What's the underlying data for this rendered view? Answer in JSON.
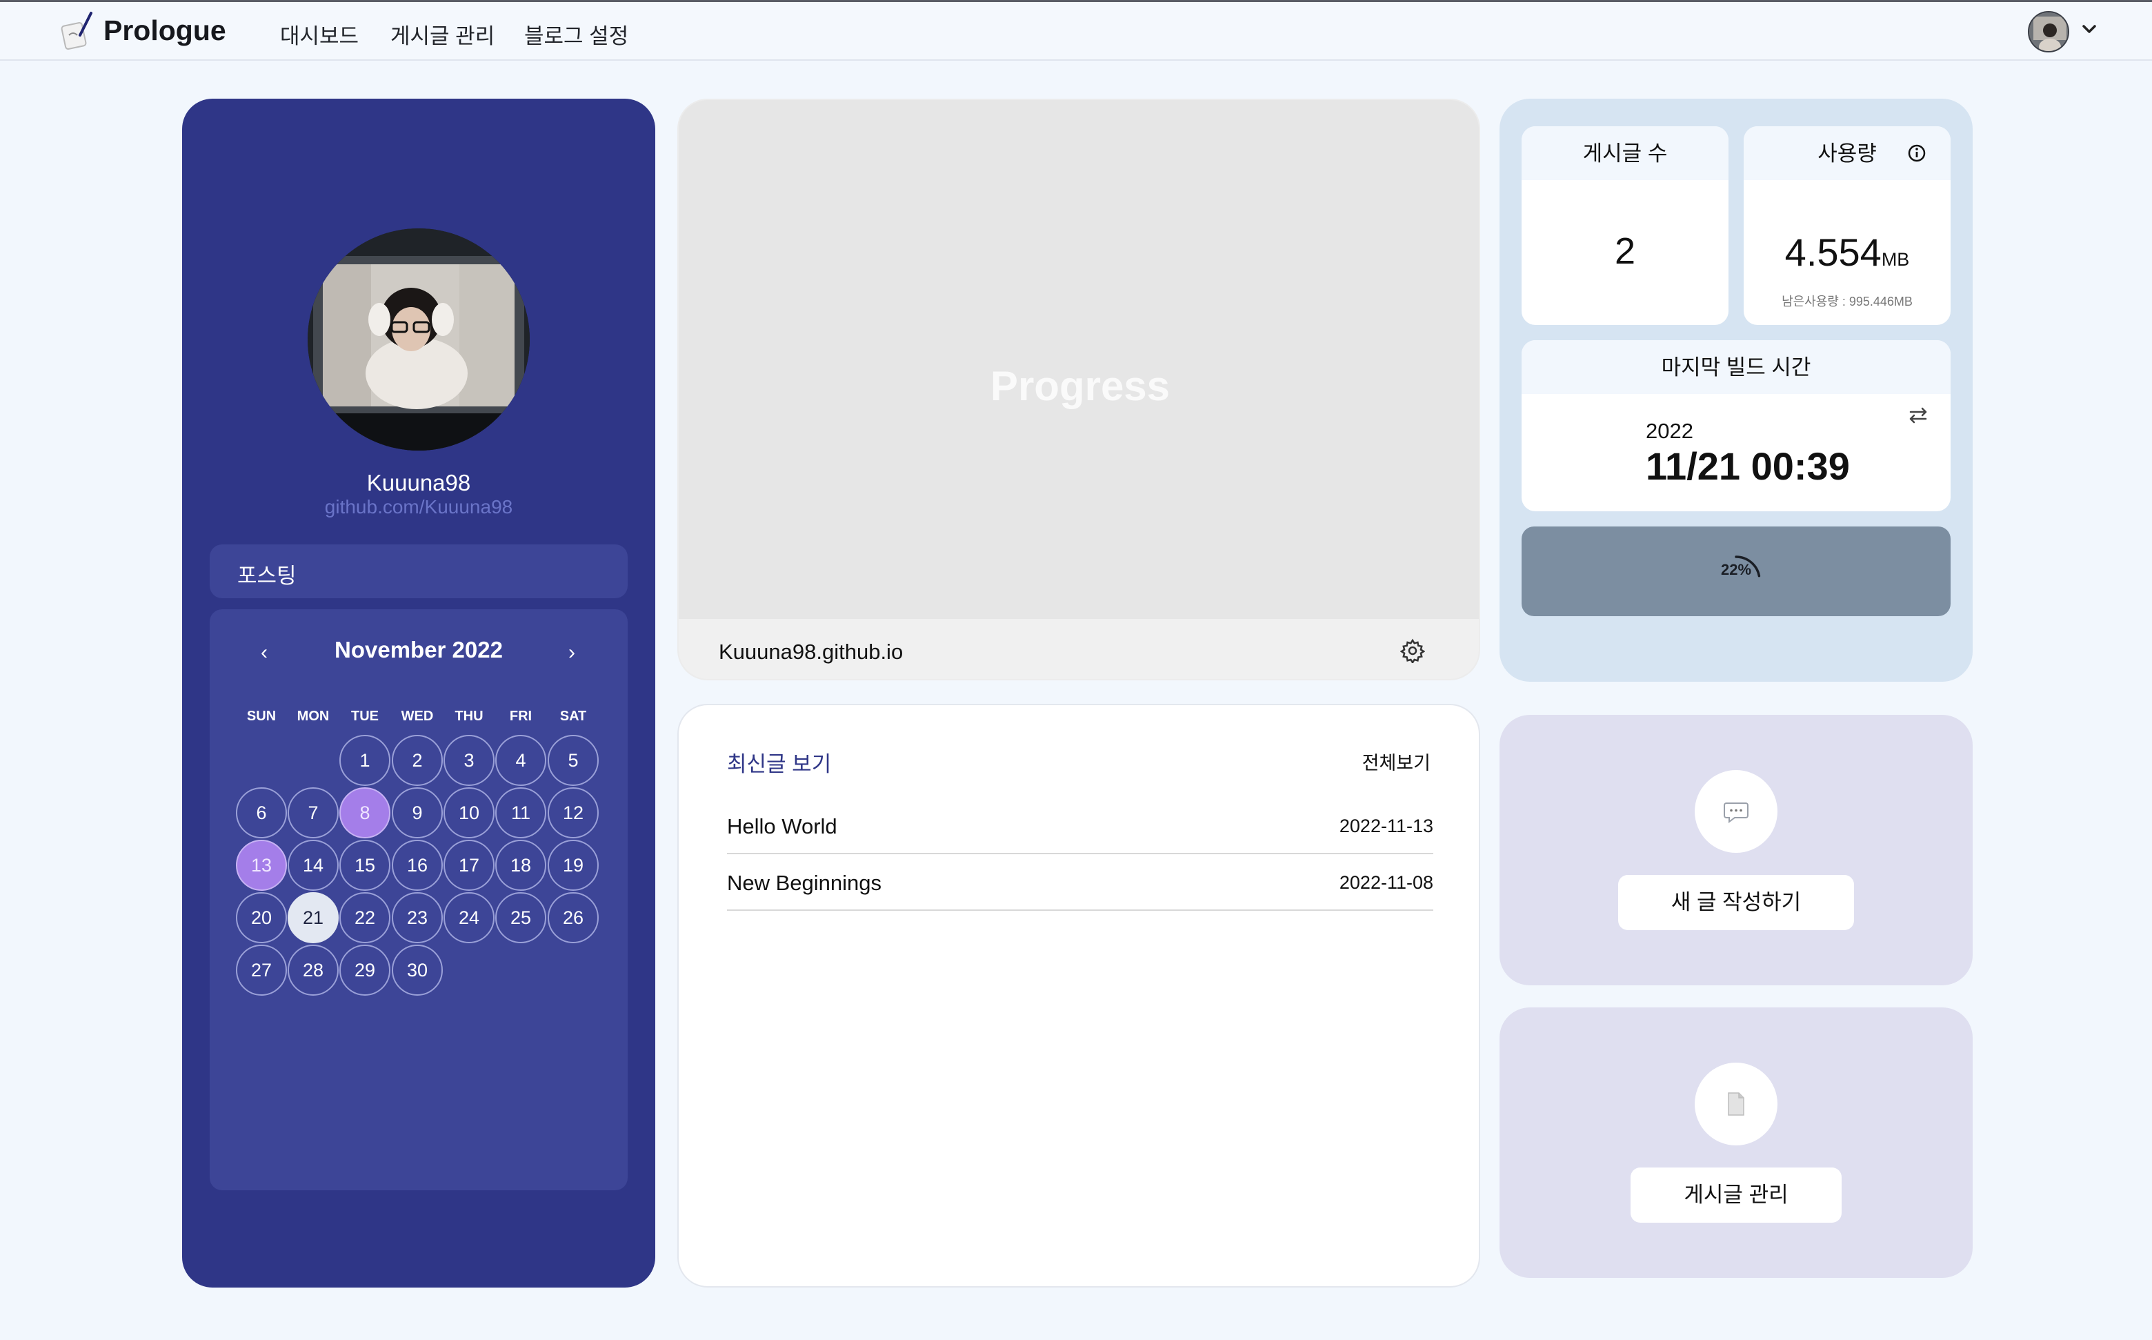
{
  "header": {
    "brand": "Prologue",
    "nav": [
      "대시보드",
      "게시글 관리",
      "블로그 설정"
    ]
  },
  "profile": {
    "username": "Kuuuna98",
    "link": "github.com/Kuuuna98",
    "posting_label": "포스팅"
  },
  "calendar": {
    "title": "November 2022",
    "prev": "‹",
    "next": "›",
    "weekdays": [
      "SUN",
      "MON",
      "TUE",
      "WED",
      "THU",
      "FRI",
      "SAT"
    ],
    "first_weekday_index": 2,
    "days": 30,
    "highlighted_days": [
      8,
      13
    ],
    "today": 21
  },
  "progress": {
    "label": "Progress",
    "site": "Kuuuna98.github.io"
  },
  "stats": {
    "post_count_label": "게시글 수",
    "post_count": "2",
    "usage_label": "사용량",
    "usage_value": "4.554",
    "usage_unit": "MB",
    "usage_remaining": "남은사용량 : 995.446MB",
    "build_label": "마지막 빌드 시간",
    "build_year": "2022",
    "build_time": "11/21 00:39",
    "gauge_text": "22%",
    "gauge_fraction": 0.22
  },
  "recent": {
    "title": "최신글 보기",
    "view_all": "전체보기",
    "posts": [
      {
        "title": "Hello World",
        "date": "2022-11-13"
      },
      {
        "title": "New Beginnings",
        "date": "2022-11-08"
      }
    ]
  },
  "actions": {
    "write": "새 글 작성하기",
    "manage": "게시글 관리"
  },
  "colors": {
    "profile_bg": "#2f3687",
    "calendar_bg": "#3d4597",
    "highlight": "#a47ee9",
    "stats_bg": "#d6e4f2",
    "action_bg": "#dfdff0"
  },
  "icons": {
    "logo": "pen-paper-icon",
    "info": "info-icon",
    "swap": "swap-icon",
    "gear": "gear-icon",
    "write": "speech-bubble-icon",
    "manage": "document-icon"
  }
}
